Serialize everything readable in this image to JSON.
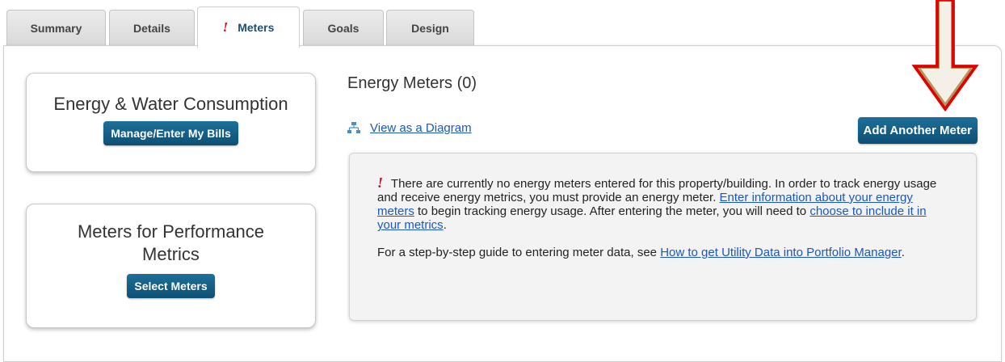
{
  "tabs": [
    {
      "label": "Summary",
      "active": false,
      "alert": ""
    },
    {
      "label": "Details",
      "active": false,
      "alert": ""
    },
    {
      "label": "Meters",
      "active": true,
      "alert": "!"
    },
    {
      "label": "Goals",
      "active": false,
      "alert": ""
    },
    {
      "label": "Design",
      "active": false,
      "alert": ""
    }
  ],
  "consumption_card": {
    "title": "Energy & Water Consumption",
    "button": "Manage/Enter My Bills"
  },
  "metrics_card": {
    "title_line1": "Meters for Performance",
    "title_line2": "Metrics",
    "button": "Select Meters"
  },
  "energy_meters": {
    "title": "Energy Meters (0)",
    "diagram_link": "View as a Diagram",
    "add_button": "Add Another Meter"
  },
  "notice": {
    "alert": "!",
    "text1": "There are currently no energy meters entered for this property/building. In order to track energy usage and receive energy metrics, you must provide an energy meter.",
    "link1": "Enter information about your energy meters",
    "text2": "to begin tracking energy usage. After entering the meter, you will need to",
    "link2": "choose to include it in your metrics",
    "text3": ".",
    "guide_text": "For a step-by-step guide to entering meter data, see",
    "guide_link": "How to get Utility Data into Portfolio Manager",
    "guide_end": "."
  },
  "colors": {
    "button": "#0e4f73",
    "link": "#1a57c4",
    "alert": "#c8102e",
    "arrow_fill": "#b5955e",
    "arrow_stroke": "#e00000"
  },
  "icons": {
    "diagram": "sitemap-icon",
    "annotation": "down-arrow-icon"
  }
}
